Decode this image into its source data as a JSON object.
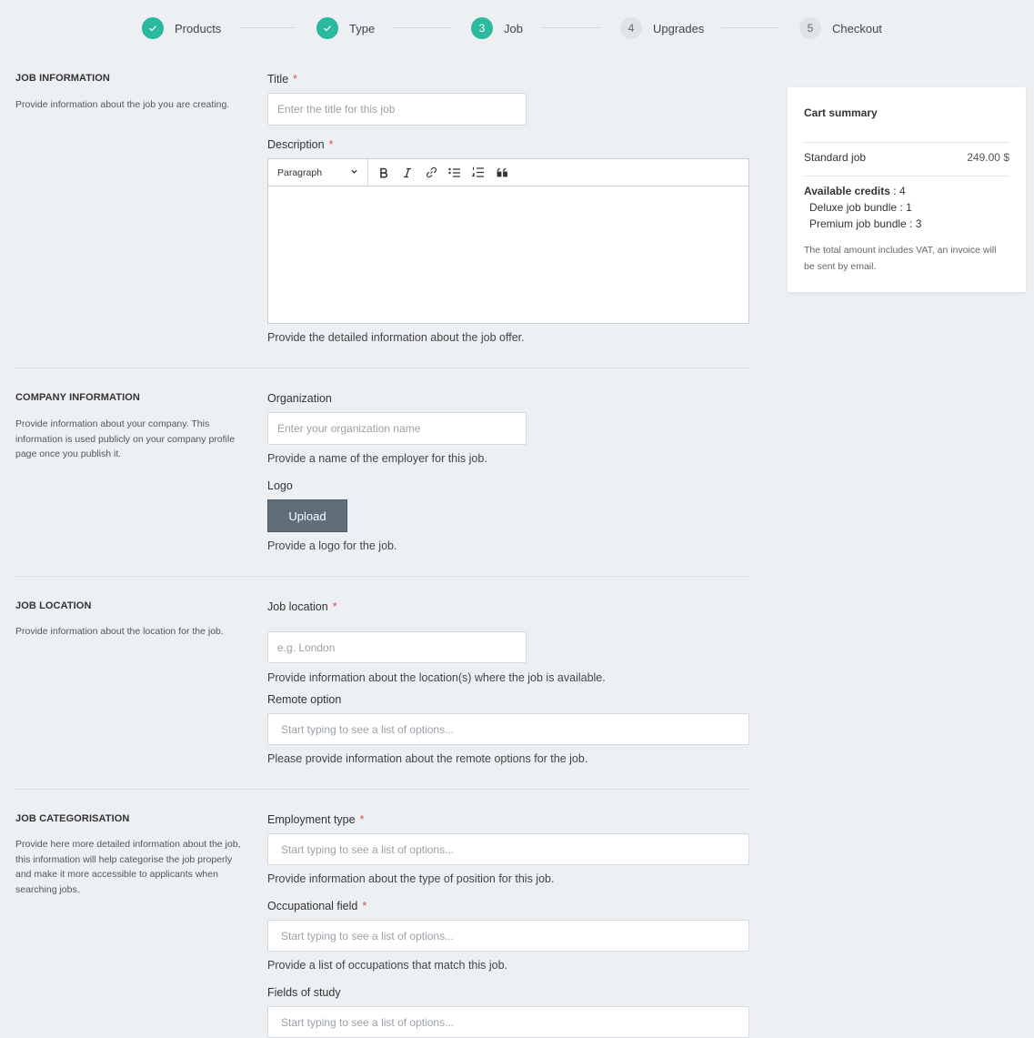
{
  "stepper": {
    "steps": [
      {
        "num": "✓",
        "label": "Products",
        "state": "done"
      },
      {
        "num": "✓",
        "label": "Type",
        "state": "done"
      },
      {
        "num": "3",
        "label": "Job",
        "state": "active"
      },
      {
        "num": "4",
        "label": "Upgrades",
        "state": "pending"
      },
      {
        "num": "5",
        "label": "Checkout",
        "state": "pending"
      }
    ]
  },
  "job_info": {
    "title": "JOB INFORMATION",
    "desc": "Provide information about the job you are creating.",
    "title_label": "Title",
    "title_placeholder": "Enter the title for this job",
    "description_label": "Description",
    "editor": {
      "paragraph": "Paragraph",
      "tools": [
        "bold-icon",
        "italic-icon",
        "link-icon",
        "bulleted-list-icon",
        "numbered-list-icon",
        "quote-icon"
      ]
    },
    "description_hint": "Provide the detailed information about the job offer."
  },
  "company_info": {
    "title": "COMPANY INFORMATION",
    "desc": "Provide information about your company. This information is used publicly on your company profile page once you publish it.",
    "org_label": "Organization",
    "org_placeholder": "Enter your organization name",
    "org_hint": "Provide a name of the employer for this job.",
    "logo_label": "Logo",
    "upload_label": "Upload",
    "logo_hint": "Provide a logo for the job."
  },
  "job_location": {
    "title": "JOB LOCATION",
    "desc": "Provide information about the location for the job.",
    "location_label": "Job location",
    "location_placeholder": "e.g. London",
    "location_hint": "Provide information about the location(s) where the job is available.",
    "remote_label": "Remote option",
    "remote_placeholder": "Start typing to see a list of options...",
    "remote_hint": "Please provide information about the remote options for the job."
  },
  "job_categorisation": {
    "title": "JOB CATEGORISATION",
    "desc": "Provide here more detailed information about the job, this information will help categorise the job properly and make it more accessible to applicants when searching jobs.",
    "employment_label": "Employment type",
    "employment_placeholder": "Start typing to see a list of options...",
    "employment_hint": "Provide information about the type of position for this job.",
    "occupational_label": "Occupational field",
    "occupational_placeholder": "Start typing to see a list of options...",
    "occupational_hint": "Provide a list of occupations that match this job.",
    "study_label": "Fields of study",
    "study_placeholder": "Start typing to see a list of options..."
  },
  "cart": {
    "title": "Cart summary",
    "item_name": "Standard job",
    "item_price": "249.00 $",
    "credits_label": "Available credits",
    "credits_value": " : 4",
    "deluxe": "Deluxe job bundle : 1",
    "premium": "Premium job bundle : 3",
    "note": "The total amount includes VAT, an invoice will be sent by email."
  },
  "colors": {
    "accent": "#2bb9a0",
    "required": "#d9534f",
    "upload_button": "#5f6e79",
    "background": "#edf0f3"
  }
}
